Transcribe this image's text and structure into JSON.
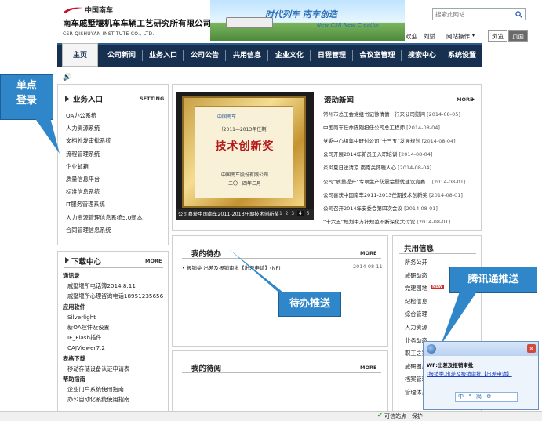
{
  "header": {
    "logo_cn": "中国南车",
    "company_name": "南车戚墅堰机车车辆工艺研究所有限公司",
    "company_en": "CSR QISHUYAN INSTITUTE CO., LTD.",
    "banner_slogan": "时代列车 南车创造",
    "banner_sub": "New CSR New Creation",
    "search_placeholder": "搜索此网站...",
    "links": [
      "欢迎",
      "刘斌",
      "网站操作"
    ],
    "view_tab": "浏览",
    "page_tab": "页面"
  },
  "nav": [
    "主页",
    "公司新闻",
    "业务入口",
    "公司公告",
    "共用信息",
    "企业文化",
    "日程管理",
    "会议室管理",
    "搜索中心",
    "系统设置"
  ],
  "business": {
    "title": "业务入口",
    "setting": "SETTING",
    "items": [
      "OA办公系统",
      "人力资源系统",
      "文档外发审批系统",
      "流程管理系统",
      "企业邮箱",
      "质量信息平台",
      "标准信息系统",
      "IT服务管理系统",
      "人力资源管理信息系统5.0新本",
      "合同管理信息系统"
    ]
  },
  "download": {
    "title": "下载中心",
    "more": "MORE",
    "items": [
      {
        "text": "通讯录",
        "cat": true
      },
      {
        "text": "戚墅堰所电话簿2014.8.11",
        "cat": false
      },
      {
        "text": "戚墅堰所心理咨询电话18951235656",
        "cat": false
      },
      {
        "text": "应用软件",
        "cat": true
      },
      {
        "text": "Silverlight",
        "cat": false
      },
      {
        "text": "新OA控件及设置",
        "cat": false
      },
      {
        "text": "IE_Flash插件",
        "cat": false
      },
      {
        "text": "CAJViewer7.2",
        "cat": false
      },
      {
        "text": "表格下载",
        "cat": true
      },
      {
        "text": "移动存储设备认证申请表",
        "cat": false
      },
      {
        "text": "帮助指南",
        "cat": true
      },
      {
        "text": "企业门户系统使用指南",
        "cat": false
      },
      {
        "text": "办公自动化系统使用指南",
        "cat": false
      }
    ]
  },
  "slideshow": {
    "caption": "公司喜获中国南车2011-2013任期技术创新奖",
    "pages": [
      "1",
      "2",
      "3",
      "4",
      "5"
    ],
    "plaque_years": "（2011—2013年任期）",
    "plaque_title": "技术创新奖",
    "plaque_org": "中国南车股份有限公司",
    "plaque_date": "二〇一四年二月",
    "plaque_logo": "中国南车"
  },
  "news": {
    "title": "滚动新闻",
    "more": "MORE",
    "items": [
      {
        "t": "常州市总工会党组书记徐倩倩一行来公司慰问",
        "d": "[2014-08-05]"
      },
      {
        "t": "中国南车任命陈刚担任公司总工程师",
        "d": "[2014-08-04]"
      },
      {
        "t": "党委中心组集中研讨公司“十三五”发展规划",
        "d": "[2014-08-04]"
      },
      {
        "t": "公司开展2014年新员工入职培训",
        "d": "[2014-08-04]"
      },
      {
        "t": "炎炎夏日送清凉 南南关怀暖人心",
        "d": "[2014-08-04]"
      },
      {
        "t": "公司“质量提升”专项生产防震会暨优建议竞赛...",
        "d": "[2014-08-01]"
      },
      {
        "t": "公司喜获中国南车2011-2013任期技术创新奖",
        "d": "[2014-08-01]"
      },
      {
        "t": "公司召开2014年安委会第四次会议",
        "d": "[2014-08-01]"
      },
      {
        "t": "“十六五”规划中方针规范不断深化大讨论",
        "d": "[2014-08-01]"
      }
    ]
  },
  "todo": {
    "title": "我的待办",
    "more": "MORE",
    "item": "报销类 出差及报销审批【出差申请】(NF)",
    "date": "2014-08-11"
  },
  "toread": {
    "title": "我的待阅",
    "more": "MORE"
  },
  "shared": {
    "title": "共用信息",
    "items": [
      "所务公开",
      "戚研动态",
      "党建园地",
      "纪检信息",
      "综合管理",
      "人力资源",
      "业务动态",
      "职工之家",
      "戚研图片",
      "档案管理",
      "管理体系"
    ],
    "new_badge": "NEW"
  },
  "callouts": {
    "sso": "单点\n登录",
    "todo_push": "待办推送",
    "im_push": "腾讯通推送"
  },
  "im": {
    "title": "WF:出差及报销审批",
    "link": "[报销类,出差及报销审批【出差申请】",
    "bar": "中 ° 简 ⚙"
  },
  "status": {
    "text": "可信站点 | 保护"
  },
  "colors": {
    "nav_bg": "#17304f",
    "callout": "#2f86c8"
  }
}
